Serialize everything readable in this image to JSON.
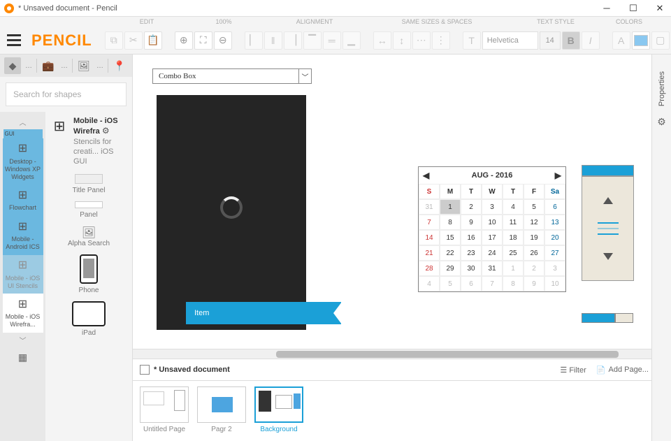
{
  "title": "* Unsaved document - Pencil",
  "logo": "PENCIL",
  "menu_labels": {
    "edit": "EDIT",
    "zoom": "100%",
    "align": "ALIGNMENT",
    "same": "SAME SIZES & SPACES",
    "text": "TEXT STYLE",
    "colors": "COLORS"
  },
  "toolbar": {
    "font_name": "Helvetica",
    "font_size": "14"
  },
  "sidebar": {
    "search_placeholder": "Search for shapes",
    "collections": [
      {
        "label": "GUI",
        "ghost": true
      },
      {
        "label": "Desktop - Windows XP Widgets"
      },
      {
        "label": "Flowchart"
      },
      {
        "label": "Mobile - Android ICS"
      },
      {
        "label": "Mobile - iOS UI Stencils"
      },
      {
        "label": "Mobile - iOS Wirefra..."
      }
    ],
    "header": {
      "title": "Mobile - iOS Wirefra",
      "desc": "Stencils for creati... iOS GUI"
    },
    "shapes": [
      {
        "label": "Title Panel"
      },
      {
        "label": "Panel"
      },
      {
        "label": "Alpha Search"
      },
      {
        "label": "Phone"
      },
      {
        "label": "iPad"
      }
    ]
  },
  "canvas": {
    "combo_text": "Combo Box",
    "ribbon_text": "Item",
    "calendar": {
      "title": "AUG - 2016",
      "days": [
        "S",
        "M",
        "T",
        "W",
        "T",
        "F",
        "Sa"
      ],
      "rows": [
        [
          {
            "d": "31",
            "o": true,
            "sun": true
          },
          {
            "d": "1",
            "sel": true
          },
          {
            "d": "2"
          },
          {
            "d": "3"
          },
          {
            "d": "4"
          },
          {
            "d": "5"
          },
          {
            "d": "6",
            "sat": true
          }
        ],
        [
          {
            "d": "7",
            "sun": true
          },
          {
            "d": "8"
          },
          {
            "d": "9"
          },
          {
            "d": "10"
          },
          {
            "d": "11"
          },
          {
            "d": "12"
          },
          {
            "d": "13",
            "sat": true
          }
        ],
        [
          {
            "d": "14",
            "sun": true
          },
          {
            "d": "15"
          },
          {
            "d": "16"
          },
          {
            "d": "17"
          },
          {
            "d": "18"
          },
          {
            "d": "19"
          },
          {
            "d": "20",
            "sat": true
          }
        ],
        [
          {
            "d": "21",
            "sun": true
          },
          {
            "d": "22"
          },
          {
            "d": "23"
          },
          {
            "d": "24"
          },
          {
            "d": "25"
          },
          {
            "d": "26"
          },
          {
            "d": "27",
            "sat": true
          }
        ],
        [
          {
            "d": "28",
            "sun": true
          },
          {
            "d": "29"
          },
          {
            "d": "30"
          },
          {
            "d": "31"
          },
          {
            "d": "1",
            "o": true
          },
          {
            "d": "2",
            "o": true
          },
          {
            "d": "3",
            "o": true
          }
        ],
        [
          {
            "d": "4",
            "o": true
          },
          {
            "d": "5",
            "o": true
          },
          {
            "d": "6",
            "o": true
          },
          {
            "d": "7",
            "o": true
          },
          {
            "d": "8",
            "o": true
          },
          {
            "d": "9",
            "o": true
          },
          {
            "d": "10",
            "o": true
          }
        ]
      ]
    }
  },
  "doc_tabs": {
    "title": "* Unsaved document",
    "filter": "Filter",
    "add_page": "Add Page..."
  },
  "pages": [
    {
      "label": "Untitled Page"
    },
    {
      "label": "Pagr 2"
    },
    {
      "label": "Background",
      "active": true
    }
  ],
  "props_label": "Properties"
}
